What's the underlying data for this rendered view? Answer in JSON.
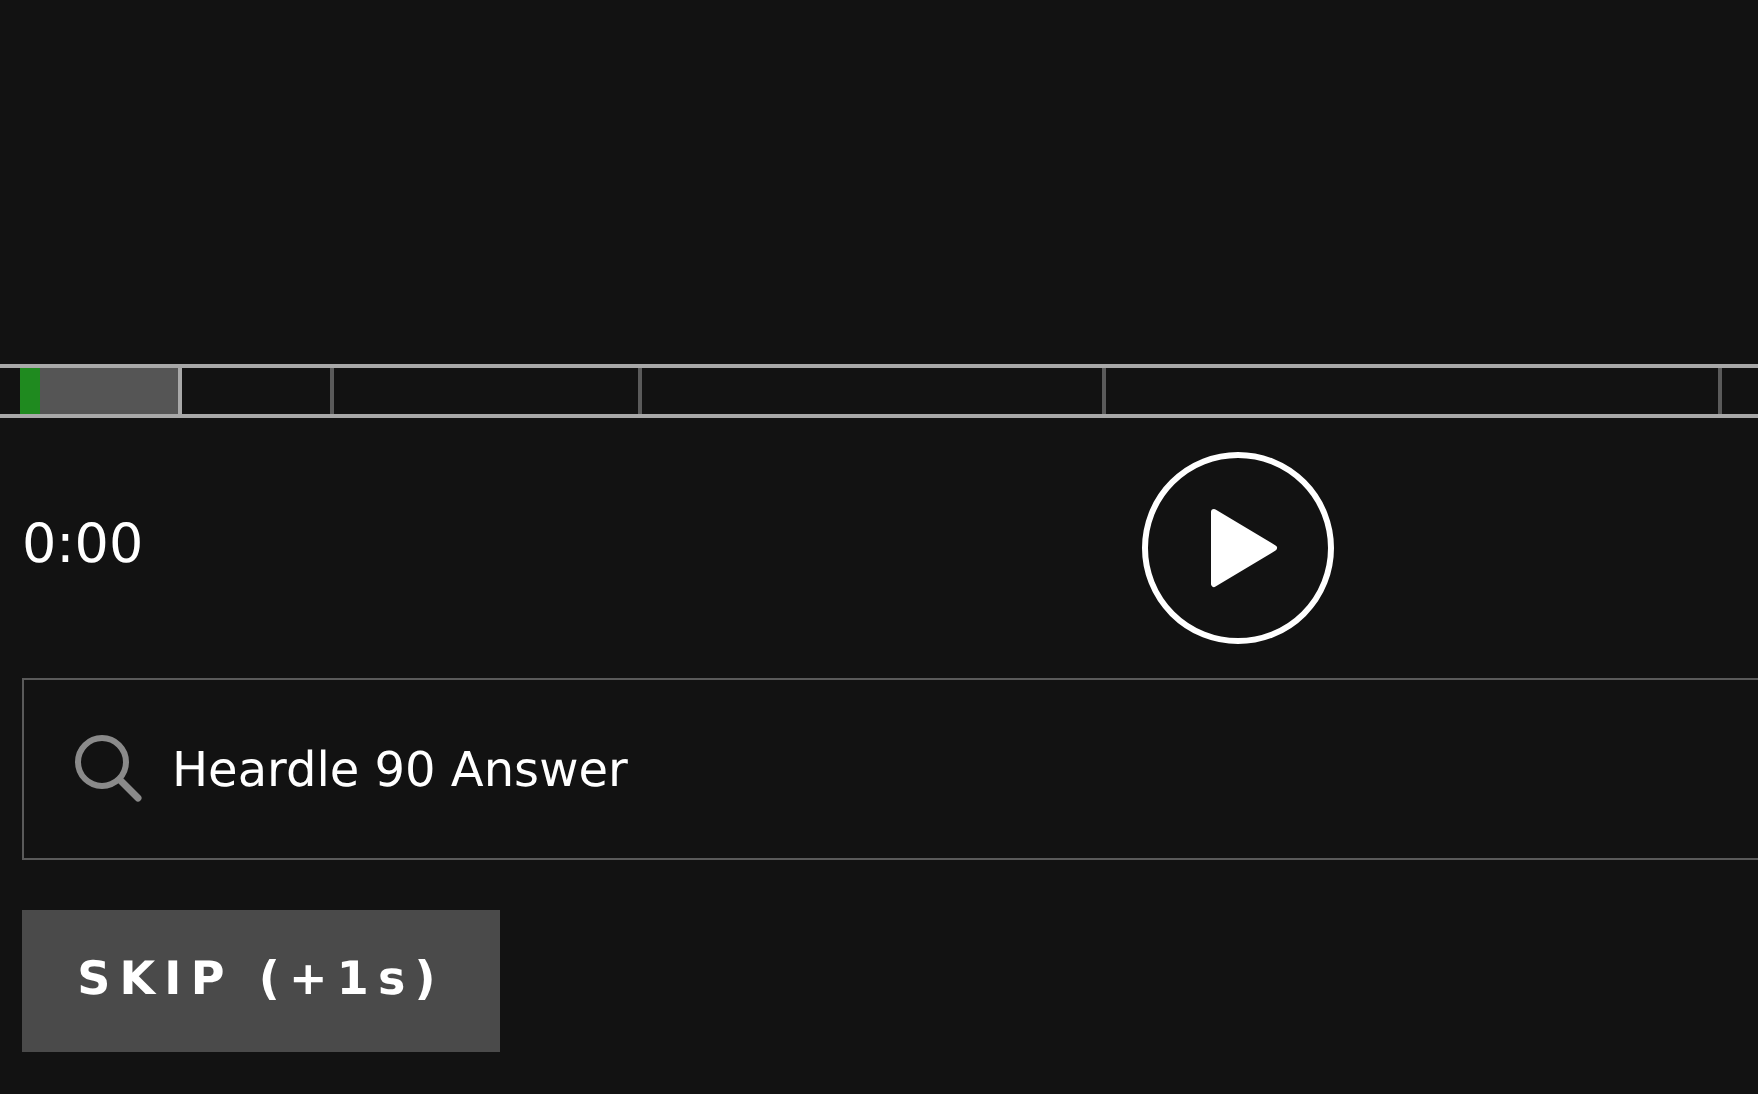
{
  "progress": {
    "level": 0.012,
    "segments": [
      {
        "unlocked": true
      },
      {
        "unlocked": false
      },
      {
        "unlocked": false
      },
      {
        "unlocked": false
      },
      {
        "unlocked": false
      },
      {
        "unlocked": false
      }
    ]
  },
  "player": {
    "time": "0:00",
    "playing": false
  },
  "search": {
    "value": "Heardle 90 Answer"
  },
  "skip_button": {
    "label": "SKIP (+1s)"
  }
}
